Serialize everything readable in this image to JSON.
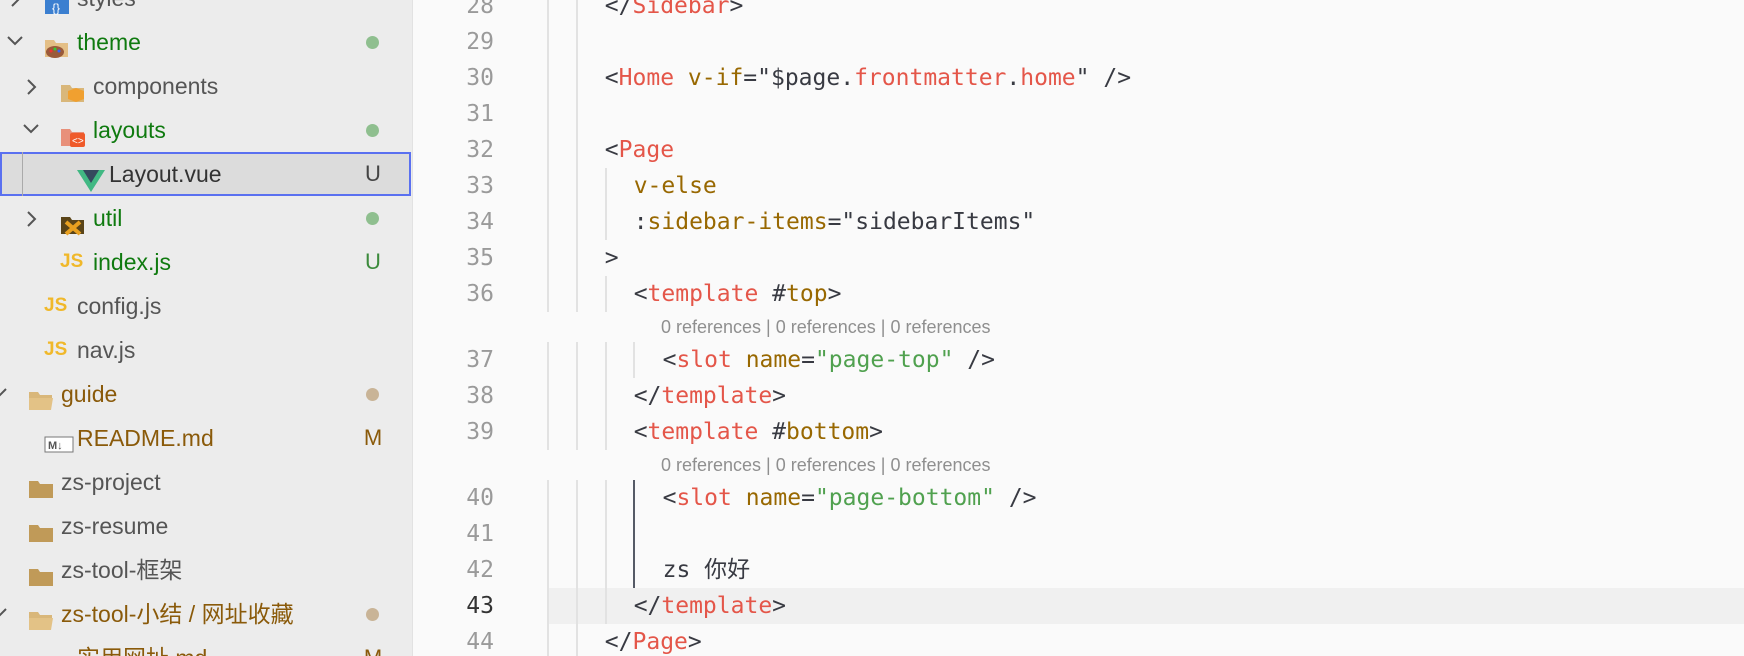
{
  "explorer": {
    "items": [
      {
        "label": "styles",
        "level": 1,
        "kind": "folder-styles",
        "chevron": "right",
        "color": "#555555"
      },
      {
        "label": "theme",
        "level": 1,
        "kind": "folder-theme",
        "chevron": "down",
        "color": "#0f7a0f",
        "dot": "#8fbf8f"
      },
      {
        "label": "components",
        "level": 2,
        "kind": "folder-components",
        "chevron": "right",
        "color": "#555555"
      },
      {
        "label": "layouts",
        "level": 2,
        "kind": "folder-layouts",
        "chevron": "down",
        "color": "#0f7a0f",
        "dot": "#8fbf8f"
      },
      {
        "label": "Layout.vue",
        "level": 3,
        "kind": "vue",
        "color": "#333333",
        "badge": "U",
        "badge_color": "#444444",
        "selected": true
      },
      {
        "label": "util",
        "level": 2,
        "kind": "folder-util",
        "chevron": "right",
        "color": "#0f7a0f",
        "dot": "#8fbf8f"
      },
      {
        "label": "index.js",
        "level": 2,
        "kind": "js",
        "color": "#0f7a0f",
        "badge": "U",
        "badge_color": "#3c8a3c"
      },
      {
        "label": "config.js",
        "level": 1,
        "kind": "js",
        "color": "#555555"
      },
      {
        "label": "nav.js",
        "level": 1,
        "kind": "js",
        "color": "#555555"
      },
      {
        "label": "guide",
        "level": 0,
        "kind": "folder-open",
        "chevron": "down",
        "color": "#8a5a0a",
        "dot": "#c9b497"
      },
      {
        "label": "README.md",
        "level": 1,
        "kind": "md",
        "color": "#8a5a0a",
        "badge": "M",
        "badge_color": "#8a5a0a"
      },
      {
        "label": "zs-project",
        "level": 0,
        "kind": "folder",
        "color": "#555555"
      },
      {
        "label": "zs-resume",
        "level": 0,
        "kind": "folder",
        "color": "#555555"
      },
      {
        "label": "zs-tool-框架",
        "level": 0,
        "kind": "folder",
        "color": "#555555"
      },
      {
        "label": "zs-tool-小结 / 网址收藏",
        "level": 0,
        "kind": "folder-open",
        "chevron": "down",
        "color": "#8a5a0a",
        "dot": "#c9b497"
      },
      {
        "label": "实用网址.md",
        "level": 1,
        "kind": "md",
        "color": "#8a5a0a",
        "badge": "M",
        "badge_color": "#8a5a0a"
      }
    ]
  },
  "editor": {
    "lines": [
      {
        "n": "28",
        "indent": 2,
        "guides": [
          0,
          1
        ],
        "tokens": [
          [
            "p",
            "</"
          ],
          [
            "t",
            "Sidebar"
          ],
          [
            "p",
            ">"
          ]
        ]
      },
      {
        "n": "29",
        "indent": 2,
        "guides": [
          0,
          1
        ],
        "tokens": []
      },
      {
        "n": "30",
        "indent": 2,
        "guides": [
          0,
          1
        ],
        "tokens": [
          [
            "p",
            "<"
          ],
          [
            "t",
            "Home"
          ],
          [
            "p",
            " "
          ],
          [
            "a",
            "v-if"
          ],
          [
            "p",
            "=\"$page."
          ],
          [
            "t",
            "frontmatter"
          ],
          [
            "p",
            "."
          ],
          [
            "t",
            "home"
          ],
          [
            "p",
            "\" />"
          ]
        ]
      },
      {
        "n": "31",
        "indent": 2,
        "guides": [
          0,
          1
        ],
        "tokens": []
      },
      {
        "n": "32",
        "indent": 2,
        "guides": [
          0,
          1
        ],
        "tokens": [
          [
            "p",
            "<"
          ],
          [
            "t",
            "Page"
          ]
        ]
      },
      {
        "n": "33",
        "indent": 3,
        "guides": [
          0,
          1,
          2
        ],
        "tokens": [
          [
            "a",
            "v-else"
          ]
        ]
      },
      {
        "n": "34",
        "indent": 3,
        "guides": [
          0,
          1,
          2
        ],
        "tokens": [
          [
            "p",
            ":"
          ],
          [
            "a",
            "sidebar-items"
          ],
          [
            "p",
            "=\"sidebarItems\""
          ]
        ]
      },
      {
        "n": "35",
        "indent": 2,
        "guides": [
          0,
          1
        ],
        "tokens": [
          [
            "p",
            ">"
          ]
        ]
      },
      {
        "n": "36",
        "indent": 3,
        "guides": [
          0,
          1,
          2
        ],
        "tokens": [
          [
            "p",
            "<"
          ],
          [
            "t",
            "template"
          ],
          [
            "p",
            " #"
          ],
          [
            "a",
            "top"
          ],
          [
            "p",
            ">"
          ]
        ]
      },
      {
        "lens": "0 references | 0 references | 0 references"
      },
      {
        "n": "37",
        "indent": 4,
        "guides": [
          0,
          1,
          2,
          3
        ],
        "tokens": [
          [
            "p",
            "<"
          ],
          [
            "t",
            "slot"
          ],
          [
            "p",
            " "
          ],
          [
            "a",
            "name"
          ],
          [
            "p",
            "="
          ],
          [
            "s",
            "\"page-top\""
          ],
          [
            "p",
            " />"
          ]
        ]
      },
      {
        "n": "38",
        "indent": 3,
        "guides": [
          0,
          1,
          2
        ],
        "tokens": [
          [
            "p",
            "</"
          ],
          [
            "t",
            "template"
          ],
          [
            "p",
            ">"
          ]
        ]
      },
      {
        "n": "39",
        "indent": 3,
        "guides": [
          0,
          1,
          2
        ],
        "tokens": [
          [
            "p",
            "<"
          ],
          [
            "t",
            "template"
          ],
          [
            "p",
            " #"
          ],
          [
            "a",
            "bottom"
          ],
          [
            "p",
            ">"
          ]
        ]
      },
      {
        "lens": "0 references | 0 references | 0 references"
      },
      {
        "n": "40",
        "indent": 4,
        "guides": [
          0,
          1,
          2,
          3
        ],
        "dark": true,
        "tokens": [
          [
            "p",
            "<"
          ],
          [
            "t",
            "slot"
          ],
          [
            "p",
            " "
          ],
          [
            "a",
            "name"
          ],
          [
            "p",
            "="
          ],
          [
            "s",
            "\"page-bottom\""
          ],
          [
            "p",
            " />"
          ]
        ]
      },
      {
        "n": "41",
        "indent": 4,
        "guides": [
          0,
          1,
          2,
          3
        ],
        "dark": true,
        "tokens": []
      },
      {
        "n": "42",
        "indent": 4,
        "guides": [
          0,
          1,
          2,
          3
        ],
        "dark": true,
        "tokens": [
          [
            "p",
            "zs 你好"
          ]
        ]
      },
      {
        "n": "43",
        "indent": 3,
        "guides": [
          0,
          1,
          2
        ],
        "active": true,
        "tokens": [
          [
            "p",
            "</"
          ],
          [
            "t",
            "template"
          ],
          [
            "p",
            ">"
          ]
        ]
      },
      {
        "n": "44",
        "indent": 2,
        "guides": [
          0,
          1
        ],
        "tokens": [
          [
            "p",
            "</"
          ],
          [
            "t",
            "Page"
          ],
          [
            "p",
            ">"
          ]
        ]
      }
    ]
  }
}
